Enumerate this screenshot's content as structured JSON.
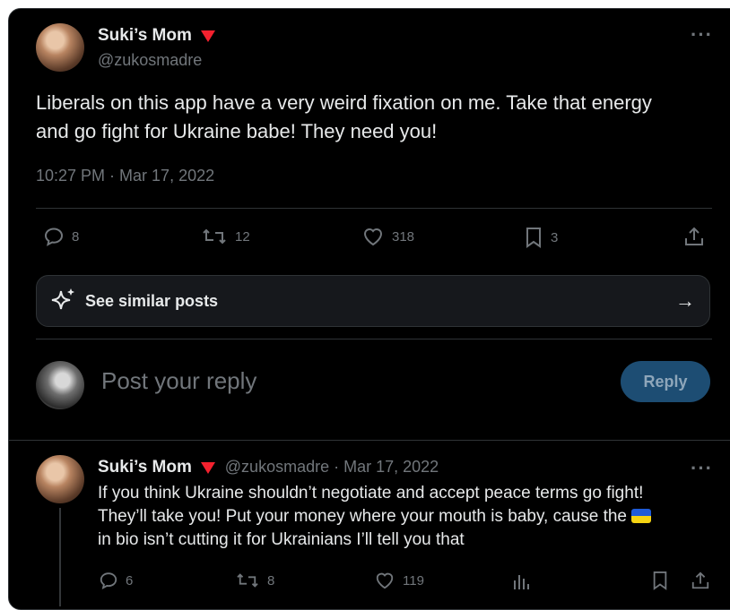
{
  "post": {
    "author_name": "Suki’s Mom",
    "author_handle": "@zukosmadre",
    "text_line1": "Liberals on this app have a very weird fixation on me. Take that energy",
    "text_line2": "and go fight for Ukraine babe! They need you!",
    "timestamp": "10:27 PM · Mar 17, 2022",
    "replies": "8",
    "reposts": "12",
    "likes": "318",
    "bookmarks": "3",
    "more_label": "···"
  },
  "similar": {
    "label": "See similar posts",
    "arrow": "→"
  },
  "composer": {
    "placeholder": "Post your reply",
    "reply_button": "Reply"
  },
  "reply": {
    "author_name": "Suki’s Mom",
    "handle_date": "@zukosmadre · Mar 17, 2022",
    "line1": "If you think Ukraine shouldn’t negotiate and accept peace terms go fight!",
    "line2_before_flag": "They’ll take you! Put your money where your mouth is baby, cause the",
    "line3": "in bio isn’t cutting it for Ukrainians I’ll tell you that",
    "replies": "6",
    "reposts": "8",
    "likes": "119",
    "more_label": "···"
  },
  "icons": {
    "badge": "red-triangle-icon",
    "flag": "ukraine-flag-icon",
    "accent_color": "#1d9bf0",
    "badge_color": "#f4212e"
  }
}
